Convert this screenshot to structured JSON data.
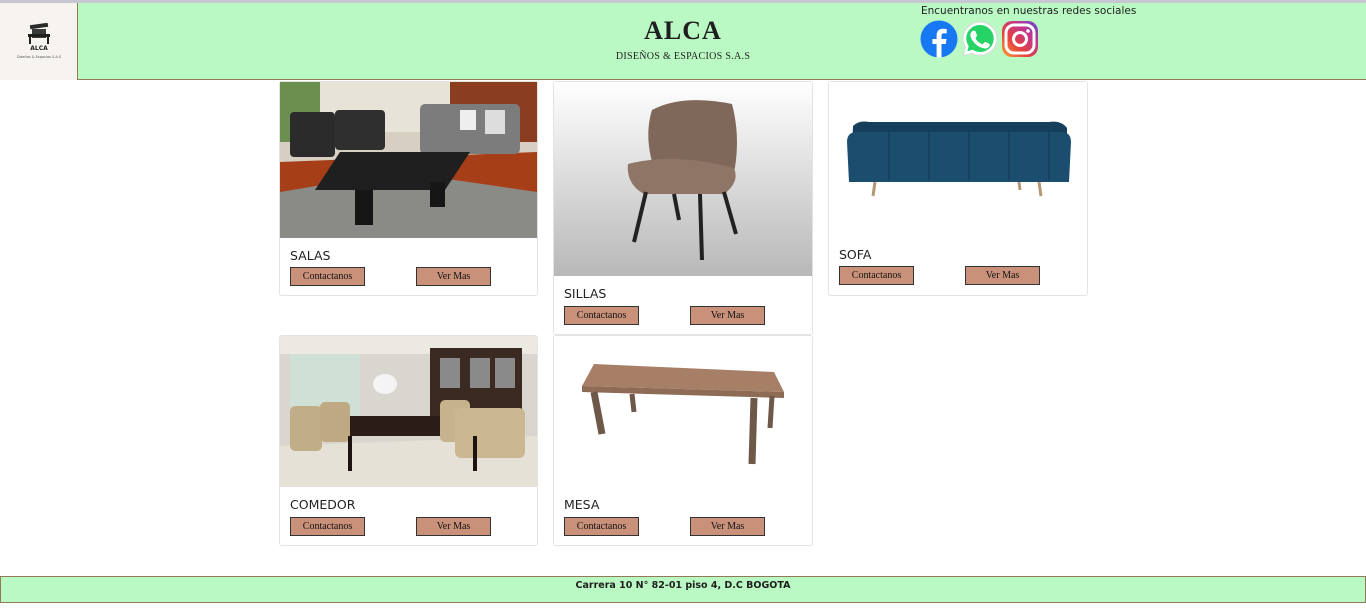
{
  "header": {
    "logo": {
      "main": "ALCA",
      "sub": "Diseños & Espacios S.A.S"
    },
    "title": "ALCA",
    "subtitle": "DISEÑOS & ESPACIOS S.A.S",
    "social_label": "Encuentranos en nuestras redes sociales",
    "social_icons": [
      "facebook-icon",
      "whatsapp-icon",
      "instagram-icon"
    ]
  },
  "products": [
    {
      "title": "SALAS",
      "contact_label": "Contactanos",
      "more_label": "Ver Mas"
    },
    {
      "title": "SILLAS",
      "contact_label": "Contactanos",
      "more_label": "Ver Mas"
    },
    {
      "title": "SOFA",
      "contact_label": "Contactanos",
      "more_label": "Ver Mas"
    },
    {
      "title": "COMEDOR",
      "contact_label": "Contactanos",
      "more_label": "Ver Mas"
    },
    {
      "title": "MESA",
      "contact_label": "Contactanos",
      "more_label": "Ver Mas"
    }
  ],
  "footer": {
    "address": "Carrera 10 N° 82-01 piso 4, D.C BOGOTA"
  },
  "colors": {
    "header_bg": "#bbf9c4",
    "button_bg": "#c9917a",
    "border": "#8f7b55"
  }
}
